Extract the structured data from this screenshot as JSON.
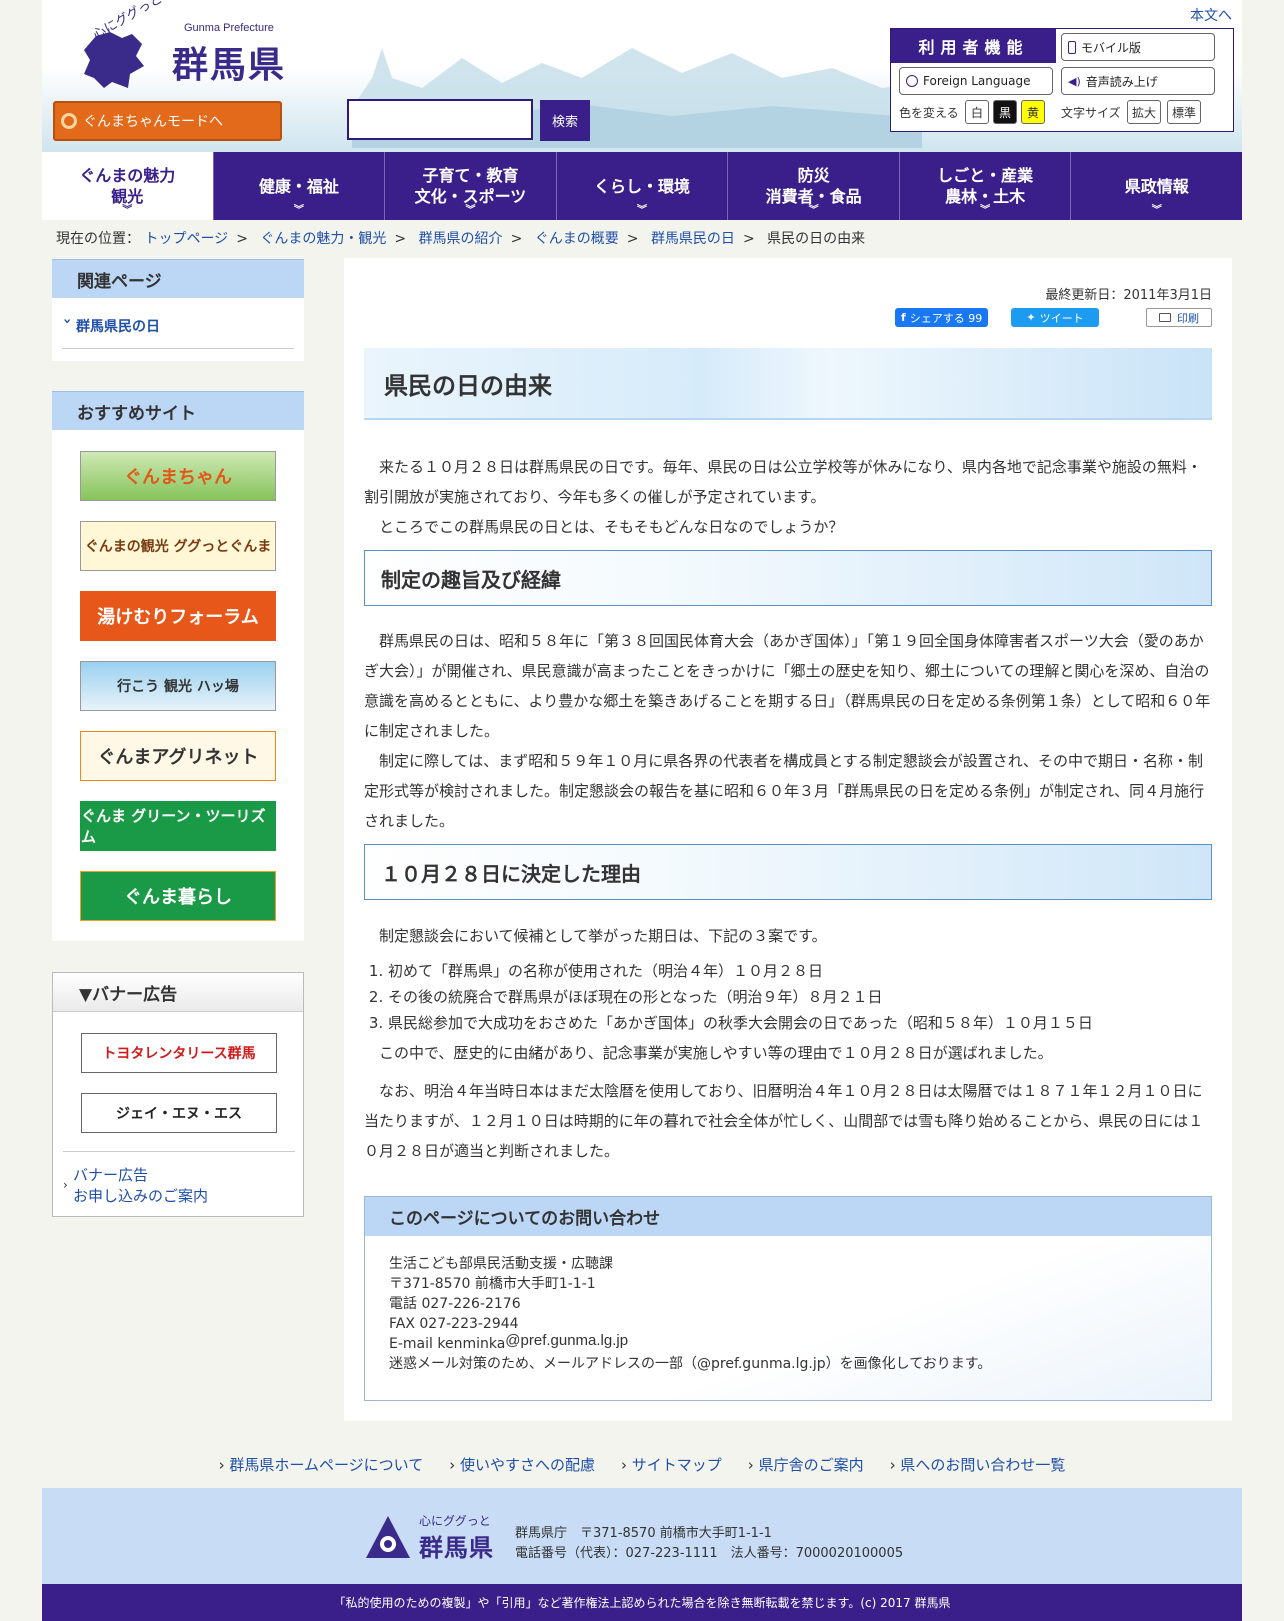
{
  "header": {
    "logo_en": "Gunma Prefecture",
    "logo_ja": "群馬県",
    "logo_tag": "心にググっと",
    "skip_link": "本文へ",
    "gunma_mode": "ぐんまちゃんモードへ",
    "search_placeholder": "",
    "search_button": "検索"
  },
  "user_panel": {
    "title": "利用者機能",
    "mobile": "モバイル版",
    "foreign": "Foreign Language",
    "voice": "音声読み上げ",
    "color_label": "色を変える",
    "color_white": "白",
    "color_black": "黒",
    "color_yellow": "黄",
    "font_label": "文字サイズ",
    "font_large": "拡大",
    "font_normal": "標準"
  },
  "gnav": [
    {
      "l1": "ぐんまの魅力",
      "l2": "観光"
    },
    {
      "l1": "健康・福祉",
      "l2": ""
    },
    {
      "l1": "子育て・教育",
      "l2": "文化・スポーツ"
    },
    {
      "l1": "くらし・環境",
      "l2": ""
    },
    {
      "l1": "防災",
      "l2": "消費者・食品"
    },
    {
      "l1": "しごと・産業",
      "l2": "農林・土木"
    },
    {
      "l1": "県政情報",
      "l2": ""
    }
  ],
  "breadcrumb": {
    "label": "現在の位置：",
    "items": [
      "トップページ",
      "ぐんまの魅力・観光",
      "群馬県の紹介",
      "ぐんまの概要",
      "群馬県民の日"
    ],
    "current": "県民の日の由来",
    "sep": ">"
  },
  "sidebar": {
    "related_title": "関連ページ",
    "related_link": "群馬県民の日",
    "recommend_title": "おすすめサイト",
    "banners": [
      "ぐんまちゃん",
      "ぐんまの観光 ググっとぐんま",
      "湯けむりフォーラム",
      "行こう 観光 ハッ場",
      "ぐんまアグリネット",
      "ぐんま グリーン・ツーリズム",
      "ぐんま暮らし"
    ],
    "ad_title": "▼バナー広告",
    "ads": [
      "トヨタレンタリース群馬",
      "ジェイ・エヌ・エス"
    ],
    "ad_link_1": "バナー広告",
    "ad_link_2": "お申し込みのご案内"
  },
  "main": {
    "updated": "最終更新日：2011年3月1日",
    "share_fb": "シェアする 99",
    "tweet": "ツイート",
    "print": "印刷",
    "title": "県民の日の由来",
    "intro1": "　来たる１０月２８日は群馬県民の日です。毎年、県民の日は公立学校等が休みになり、県内各地で記念事業や施設の無料・割引開放が実施されており、今年も多くの催しが予定されています。",
    "intro2": "　ところでこの群馬県民の日とは、そもそもどんな日なのでしょうか？",
    "h2a": "制定の趣旨及び経緯",
    "p1": "　群馬県民の日は、昭和５８年に「第３８回国民体育大会（あかぎ国体）」「第１９回全国身体障害者スポーツ大会（愛のあかぎ大会）」が開催され、県民意識が高まったことをきっかけに「郷土の歴史を知り、郷土についての理解と関心を深め、自治の意識を高めるとともに、より豊かな郷土を築きあげることを期する日」（群馬県民の日を定める条例第１条）として昭和６０年に制定されました。",
    "p2": "　制定に際しては、まず昭和５９年１０月に県各界の代表者を構成員とする制定懇談会が設置され、その中で期日・名称・制定形式等が検討されました。制定懇談会の報告を基に昭和６０年３月「群馬県民の日を定める条例」が制定され、同４月施行されました。",
    "h2b": "１０月２８日に決定した理由",
    "p3": "　制定懇談会において候補として挙がった期日は、下記の３案です。",
    "list": [
      "初めて「群馬県」の名称が使用された（明治４年）１０月２８日",
      "その後の統廃合で群馬県がほぼ現在の形となった（明治９年）８月２１日",
      "県民総参加で大成功をおさめた「あかぎ国体」の秋季大会開会の日であった（昭和５８年）１０月１５日"
    ],
    "p4": "　この中で、歴史的に由緒があり、記念事業が実施しやすい等の理由で１０月２８日が選ばれました。",
    "p5": "　なお、明治４年当時日本はまだ太陰暦を使用しており、旧暦明治４年１０月２８日は太陽暦では１８７１年１２月１０日に当たりますが、１２月１０日は時期的に年の暮れで社会全体が忙しく、山間部では雪も降り始めることから、県民の日には１０月２８日が適当と判断されました。"
  },
  "contact": {
    "title": "このページについてのお問い合わせ",
    "dept": "生活こども部県民活動支援・広聴課",
    "address": "〒371-8570 前橋市大手町1-1-1",
    "tel": "電話 027-226-2176",
    "fax": "FAX 027-223-2944",
    "email": "E-mail kenminka",
    "email_img": "@pref.gunma.lg.jp",
    "note": "迷惑メール対策のため、メールアドレスの一部（@pref.gunma.lg.jp）を画像化しております。"
  },
  "footer": {
    "links": [
      "群馬県ホームページについて",
      "使いやすさへの配慮",
      "サイトマップ",
      "県庁舎のご案内",
      "県へのお問い合わせ一覧"
    ],
    "logo_tag": "心にググっと",
    "logo_name": "群馬県",
    "info1": "群馬県庁　〒371-8570 前橋市大手町1-1-1",
    "info2": "電話番号（代表）：027-223-1111　法人番号：7000020100005",
    "copyright": "「私的使用のための複製」や「引用」など著作権法上認められた場合を除き無断転載を禁じます。(c) 2017 群馬県"
  }
}
